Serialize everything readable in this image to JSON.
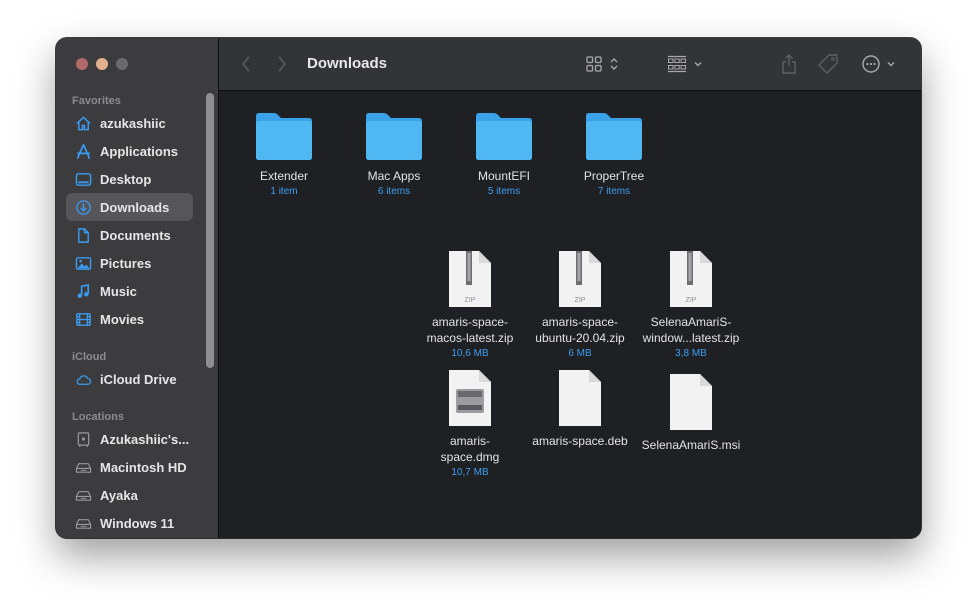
{
  "window": {
    "title": "Downloads",
    "traffic_lights": [
      "close",
      "minimize",
      "maximize"
    ]
  },
  "toolbar": {
    "back_icon": "chevron-left-icon",
    "forward_icon": "chevron-right-icon",
    "view_icon": "icon-grid-icon",
    "group_icon": "group-by-icon",
    "share_icon": "share-icon",
    "tag_icon": "tag-icon",
    "more_icon": "ellipsis-circle-icon",
    "search_icon": "search-icon"
  },
  "sidebar": {
    "sections": [
      {
        "title": "Favorites",
        "items": [
          {
            "label": "azukashiic",
            "icon": "home-icon"
          },
          {
            "label": "Applications",
            "icon": "applications-icon"
          },
          {
            "label": "Desktop",
            "icon": "desktop-icon"
          },
          {
            "label": "Downloads",
            "icon": "downloads-icon",
            "selected": true
          },
          {
            "label": "Documents",
            "icon": "document-icon"
          },
          {
            "label": "Pictures",
            "icon": "pictures-icon"
          },
          {
            "label": "Music",
            "icon": "music-icon"
          },
          {
            "label": "Movies",
            "icon": "movies-icon"
          }
        ]
      },
      {
        "title": "iCloud",
        "items": [
          {
            "label": "iCloud Drive",
            "icon": "cloud-icon"
          }
        ]
      },
      {
        "title": "Locations",
        "items": [
          {
            "label": "Azukashiic's...",
            "icon": "computer-icon"
          },
          {
            "label": "Macintosh HD",
            "icon": "disk-icon"
          },
          {
            "label": "Ayaka",
            "icon": "disk-icon"
          },
          {
            "label": "Windows 11",
            "icon": "disk-icon"
          }
        ]
      }
    ]
  },
  "content": {
    "folders": [
      {
        "name": "Extender",
        "sub": "1 item"
      },
      {
        "name": "Mac Apps",
        "sub": "6 items"
      },
      {
        "name": "MountEFI",
        "sub": "5 items"
      },
      {
        "name": "ProperTree",
        "sub": "7 items"
      }
    ],
    "files": [
      {
        "name_line1": "amaris-space-",
        "name_line2": "macos-latest.zip",
        "sub": "10,6 MB",
        "type": "zip",
        "badge": "ZIP"
      },
      {
        "name_line1": "amaris-space-",
        "name_line2": "ubuntu-20.04.zip",
        "sub": "6 MB",
        "type": "zip",
        "badge": "ZIP"
      },
      {
        "name_line1": "SelenaAmariS-",
        "name_line2": "window...latest.zip",
        "sub": "3,8 MB",
        "type": "zip",
        "badge": "ZIP"
      },
      {
        "name_line1": "amaris-",
        "name_line2": "space.dmg",
        "sub": "10,7 MB",
        "type": "dmg"
      },
      {
        "name_line1": "amaris-space.deb",
        "name_line2": "",
        "sub": "",
        "type": "blank"
      },
      {
        "name_line1": "SelenaAmariS.msi",
        "name_line2": "",
        "sub": "",
        "type": "blank"
      }
    ]
  },
  "colors": {
    "accent": "#3d9cf0",
    "folder": "#46b1f0",
    "sidebar_bg": "#3c3c3e",
    "content_bg": "#1f2023",
    "toolbar_bg": "#333438"
  }
}
